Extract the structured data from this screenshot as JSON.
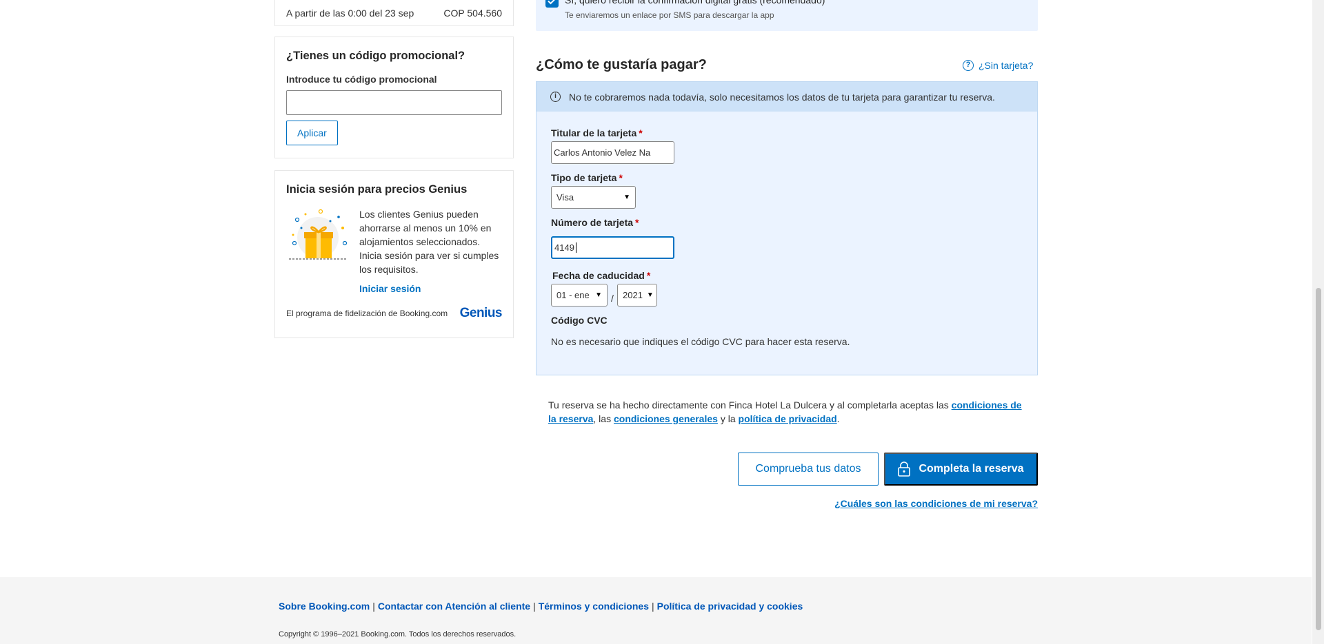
{
  "summary": {
    "price_label": "A partir de las 0:00 del 23 sep",
    "price_value": "COP 504.560"
  },
  "promo": {
    "title": "¿Tienes un código promocional?",
    "label": "Introduce tu código promocional",
    "value": "",
    "apply_button": "Aplicar"
  },
  "genius": {
    "title": "Inicia sesión para precios Genius",
    "description": "Los clientes Genius pueden ahorrarse al menos un 10% en alojamientos seleccionados. Inicia sesión para ver si cumples los requisitos.",
    "login_link": "Iniciar sesión",
    "program_text": "El programa de fidelización de Booking.com",
    "logo_text": "Genius"
  },
  "confirmation": {
    "checkbox_label": "Sí, quiero recibir la confirmación digital gratis (recomendado)",
    "checked": true,
    "sms_note": "Te enviaremos un enlace por SMS para descargar la app"
  },
  "payment": {
    "title": "¿Cómo te gustaría pagar?",
    "no_card_link": "¿Sin tarjeta?",
    "info_text": "No te cobraremos nada todavía, solo necesitamos los datos de tu tarjeta para garantizar tu reserva.",
    "holder_label": "Titular de la tarjeta",
    "holder_value": "Carlos Antonio Velez Na",
    "card_type_label": "Tipo de tarjeta",
    "card_type_value": "Visa",
    "card_number_label": "Número de tarjeta",
    "card_number_value": "4149",
    "expiry_label": "Fecha de caducidad",
    "expiry_month": "01 - ene",
    "expiry_year": "2021",
    "expiry_separator": "/",
    "required_mark": "*",
    "cvc_title": "Código CVC",
    "cvc_text": "No es necesario que indiques el código CVC para hacer esta reserva."
  },
  "terms": {
    "text_1": "Tu reserva se ha hecho directamente con Finca Hotel La Dulcera y al completarla aceptas las ",
    "link_conditions": "condiciones de la reserva",
    "text_2": ", las ",
    "link_general": "condiciones generales",
    "text_3": " y la ",
    "link_privacy": "política de privacidad",
    "text_4": "."
  },
  "actions": {
    "check_button": "Comprueba tus datos",
    "complete_button": "Completa la reserva",
    "conditions_link": "¿Cuáles son las condiciones de mi reserva?"
  },
  "footer": {
    "links": [
      "Sobre Booking.com",
      "Contactar con Atención al cliente",
      "Términos y condiciones",
      "Política de privacidad y cookies"
    ],
    "separator": "|",
    "copyright": "Copyright © 1996–2021 Booking.com. Todos los derechos reservados."
  },
  "icons": {
    "checkbox": "checkmark-icon",
    "help": "question-circle-icon",
    "info": "info-circle-icon",
    "gift": "gift-icon",
    "lock": "lock-icon",
    "chevron": "chevron-down-icon"
  },
  "colors": {
    "brand_blue": "#0071c2",
    "panel_bg": "#ebf3ff",
    "banner_bg": "#cde2f8",
    "required_red": "#cc0000"
  }
}
